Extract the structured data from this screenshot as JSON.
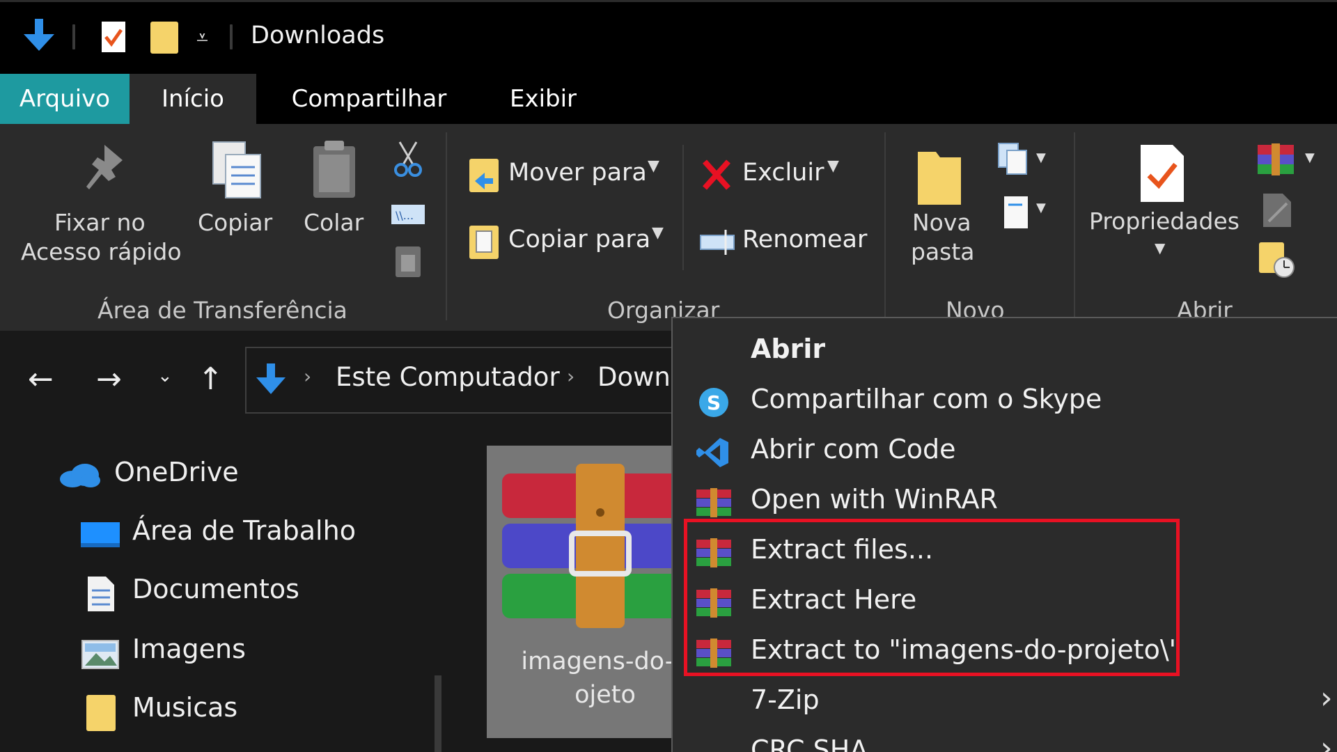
{
  "window": {
    "title": "Downloads"
  },
  "tabs": [
    {
      "label": "Arquivo"
    },
    {
      "label": "Início"
    },
    {
      "label": "Compartilhar"
    },
    {
      "label": "Exibir"
    }
  ],
  "ribbon": {
    "pin_label_line1": "Fixar no",
    "pin_label_line2": "Acesso rápido",
    "copy_label": "Copiar",
    "paste_label": "Colar",
    "clipboard_group": "Área de Transferência",
    "move_to": "Mover para",
    "copy_to": "Copiar para",
    "delete": "Excluir",
    "rename": "Renomear",
    "organize_group": "Organizar",
    "new_folder_line1": "Nova",
    "new_folder_line2": "pasta",
    "new_group": "Novo",
    "properties": "Propriedades",
    "open_group": "Abrir"
  },
  "address": {
    "crumbs": [
      "Este Computador",
      "Down"
    ]
  },
  "nav": {
    "items": [
      {
        "label": "OneDrive"
      },
      {
        "label": "Área de Trabalho"
      },
      {
        "label": "Documentos"
      },
      {
        "label": "Imagens"
      },
      {
        "label": "Musicas"
      }
    ]
  },
  "file": {
    "name_line1": "imagens-do-p",
    "name_line2": "ojeto"
  },
  "context_menu": {
    "items": [
      {
        "label": "Abrir"
      },
      {
        "label": "Compartilhar com o Skype"
      },
      {
        "label": "Abrir com Code"
      },
      {
        "label": "Open with WinRAR"
      },
      {
        "label": "Extract files..."
      },
      {
        "label": "Extract Here"
      },
      {
        "label": "Extract to \"imagens-do-projeto\\\""
      },
      {
        "label": "7-Zip"
      },
      {
        "label": "CRC SHA"
      }
    ]
  },
  "colors": {
    "accent_tab": "#1e9aa0",
    "highlight_border": "#e81123",
    "download_arrow": "#2f8fe8",
    "folder_yellow": "#f5d36a"
  }
}
